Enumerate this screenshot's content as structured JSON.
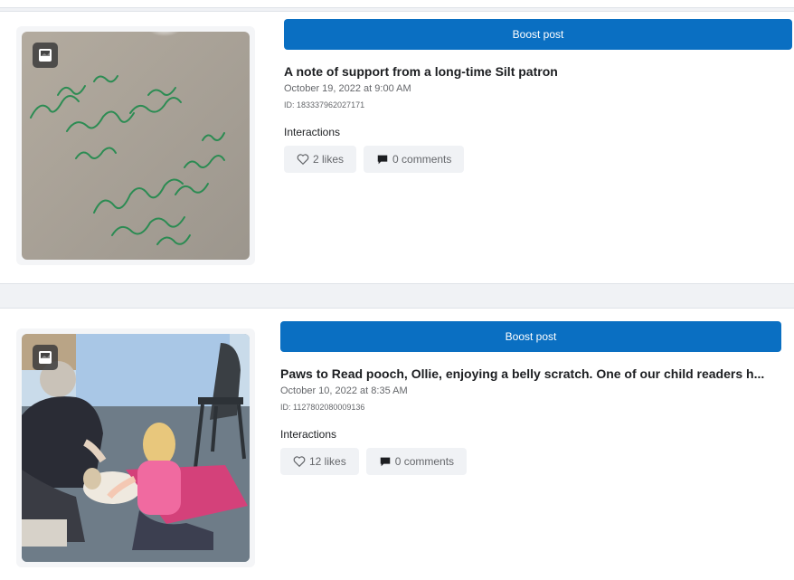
{
  "posts": [
    {
      "boost_label": "Boost post",
      "title": "A note of support from a long-time Silt patron",
      "date": "October 19, 2022 at 9:00 AM",
      "id": "ID: 183337962027171",
      "interactions_label": "Interactions",
      "likes": "2 likes",
      "comments": "0 comments",
      "media_type_icon": "photo-album-icon",
      "note_lines": [
        "To: The",
        "Silt ...",
        "All the care",
        "and ...",
        "We appreciate you!",
        "For...",
        "your..."
      ]
    },
    {
      "boost_label": "Boost post",
      "title": "Paws to Read pooch, Ollie, enjoying a belly scratch. One of our child readers h...",
      "date": "October 10, 2022 at 8:35 AM",
      "id": "ID: 1127802080009136",
      "interactions_label": "Interactions",
      "likes": "12 likes",
      "comments": "0 comments",
      "media_type_icon": "photo-album-icon"
    }
  ],
  "colors": {
    "boost_button": "#0a6fc2",
    "background": "#f0f2f5",
    "card": "#ffffff",
    "chip": "#f0f2f5",
    "marker_ink": "#1f8a4c"
  },
  "icons": [
    "photo-album-icon",
    "heart-icon",
    "comment-icon"
  ]
}
